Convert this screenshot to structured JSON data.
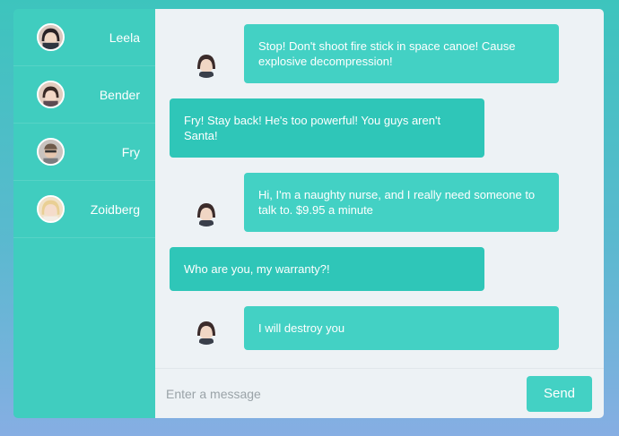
{
  "contacts": [
    {
      "name": "Leela",
      "avatar": "leela-avatar-icon"
    },
    {
      "name": "Bender",
      "avatar": "bender-avatar-icon"
    },
    {
      "name": "Fry",
      "avatar": "fry-avatar-icon"
    },
    {
      "name": "Zoidberg",
      "avatar": "zoidberg-avatar-icon"
    }
  ],
  "messages": [
    {
      "direction": "outgoing",
      "text": "Stop! Don't shoot fire stick in space canoe! Cause explosive decompression!"
    },
    {
      "direction": "incoming",
      "text": "Fry! Stay back! He's too powerful! You guys aren't Santa!"
    },
    {
      "direction": "outgoing",
      "text": "Hi, I'm a naughty nurse, and I really need someone to talk to. $9.95 a minute"
    },
    {
      "direction": "incoming",
      "text": "Who are you, my warranty?!"
    },
    {
      "direction": "outgoing",
      "text": "I will destroy you"
    }
  ],
  "composer": {
    "placeholder": "Enter a message",
    "send_label": "Send"
  },
  "colors": {
    "sidebar": "#40cdbf",
    "outgoing_bubble": "#43d1c4",
    "incoming_bubble": "#2fc6b8",
    "chat_background": "#edf2f5"
  }
}
